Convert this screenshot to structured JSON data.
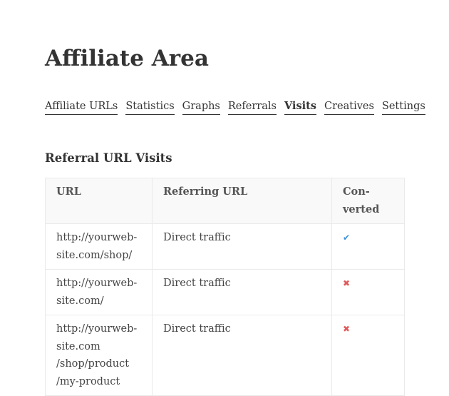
{
  "page": {
    "title": "Affiliate Area"
  },
  "tabs": [
    {
      "label": "Affiliate URLs",
      "active": false
    },
    {
      "label": "Statistics",
      "active": false
    },
    {
      "label": "Graphs",
      "active": false
    },
    {
      "label": "Referrals",
      "active": false
    },
    {
      "label": "Visits",
      "active": true
    },
    {
      "label": "Creatives",
      "active": false
    },
    {
      "label": "Settings",
      "active": false
    }
  ],
  "section": {
    "title": "Referral URL Visits"
  },
  "table": {
    "headers": {
      "url": "URL",
      "referring_url": "Referring URL",
      "converted_line1": "Con-",
      "converted_line2": "verted"
    },
    "rows": [
      {
        "url": "http://yourweb-site.com/shop/",
        "referring_url": "Direct traffic",
        "converted": true,
        "converted_icon": "check-icon"
      },
      {
        "url": "http://yourweb-site.com/",
        "referring_url": "Direct traffic",
        "converted": false,
        "converted_icon": "cross-icon"
      },
      {
        "url": "http://yourweb-site.com /shop/product /my-product",
        "referring_url": "Direct traffic",
        "converted": false,
        "converted_icon": "cross-icon"
      }
    ]
  },
  "colors": {
    "converted_yes": "#3a8fd6",
    "converted_no": "#e05a5a"
  }
}
